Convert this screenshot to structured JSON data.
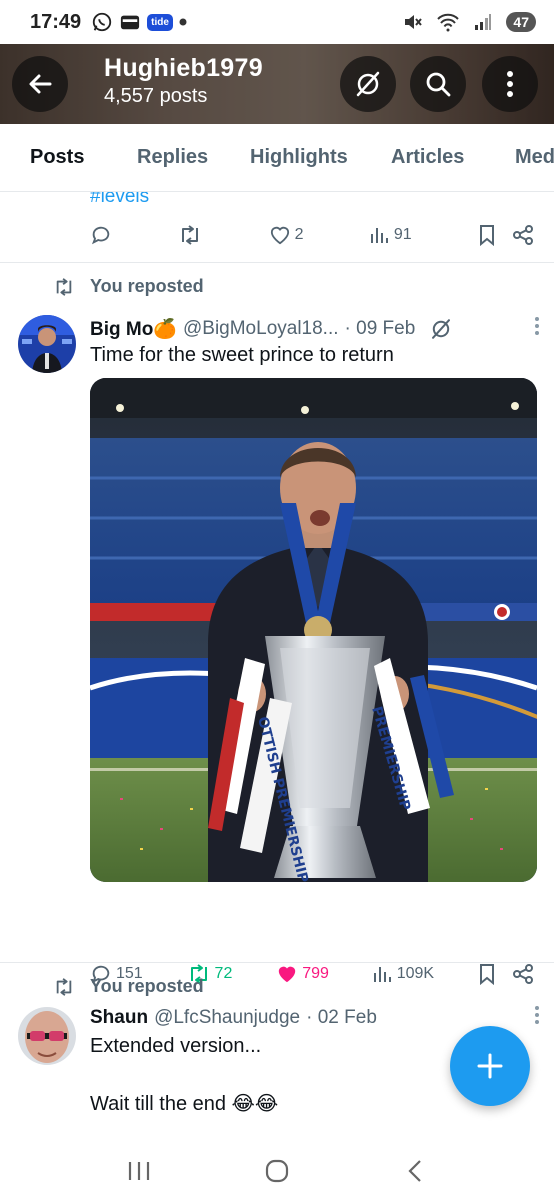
{
  "status_bar": {
    "time": "17:49",
    "tide_label": "tide",
    "battery": "47"
  },
  "profile": {
    "name": "Hughieb1979",
    "post_count": "4,557 posts"
  },
  "tabs": [
    {
      "label": "Posts",
      "active": true
    },
    {
      "label": "Replies"
    },
    {
      "label": "Highlights"
    },
    {
      "label": "Articles"
    },
    {
      "label": "Media"
    }
  ],
  "previous_post": {
    "hashtag": "#levels",
    "replies": "",
    "reposts": "",
    "likes": "2",
    "views": "91"
  },
  "posts": [
    {
      "repost_label": "You reposted",
      "name": "Big Mo🍊",
      "handle": "@BigMoLoyal18...",
      "date": "· 09 Feb",
      "text": "Time for the sweet prince to return",
      "image_text": {
        "ribbon_left": "OTTISH PREMIERSHIP",
        "ribbon_right": "PREMIERSHIP"
      },
      "stats": {
        "replies": "151",
        "reposts": "72",
        "likes": "799",
        "views": "109K"
      }
    },
    {
      "repost_label": "You reposted",
      "name": "Shaun",
      "handle": "@LfcShaunjudge",
      "date": "· 02 Feb",
      "text_line1": "Extended version...",
      "text_line2": "Wait till the end 😂😂"
    }
  ],
  "colors": {
    "accent": "#1d9bf0",
    "repost_green": "#00ba7c",
    "like_pink": "#f91880",
    "muted": "#536471"
  }
}
